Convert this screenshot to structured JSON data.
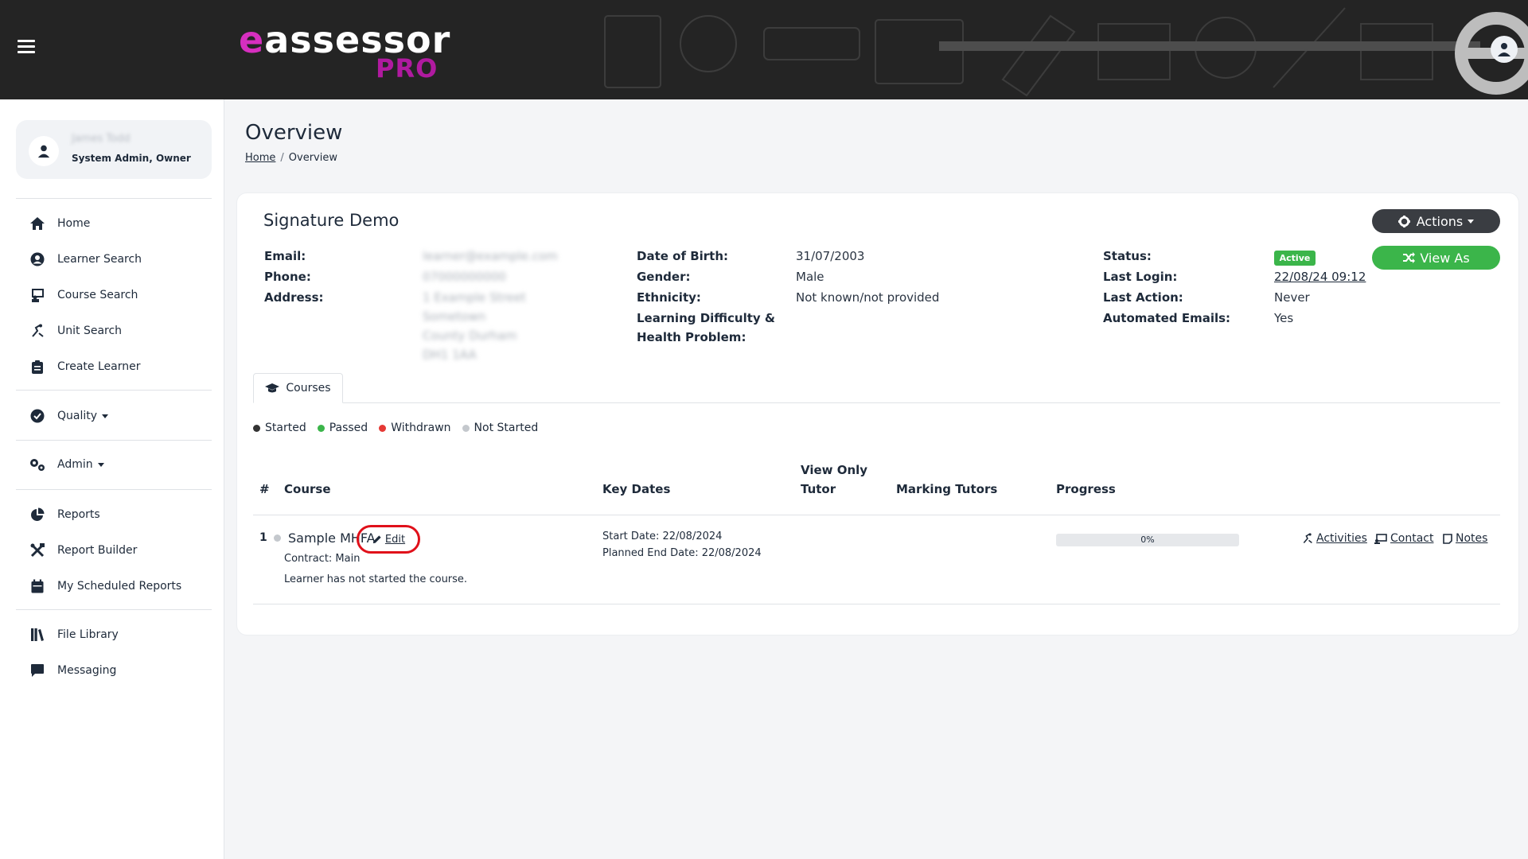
{
  "app": {
    "logo_main_e": "e",
    "logo_main_rest": "assessor",
    "logo_sub": "PRO"
  },
  "user": {
    "name": "James Todd",
    "role": "System Admin, Owner"
  },
  "nav": {
    "home": "Home",
    "learner_search": "Learner Search",
    "course_search": "Course Search",
    "unit_search": "Unit Search",
    "create_learner": "Create Learner",
    "quality": "Quality",
    "admin": "Admin",
    "reports": "Reports",
    "report_builder": "Report Builder",
    "scheduled_reports": "My Scheduled Reports",
    "file_library": "File Library",
    "messaging": "Messaging"
  },
  "page": {
    "title": "Overview",
    "breadcrumb_home": "Home",
    "breadcrumb_current": "Overview"
  },
  "learner": {
    "name": "Signature Demo",
    "actions_label": "Actions",
    "view_as_label": "View As",
    "email_label": "Email:",
    "email_value": "learner@example.com",
    "phone_label": "Phone:",
    "phone_value": "07000000000",
    "address_label": "Address:",
    "address_lines": [
      "1 Example Street",
      "Sometown",
      "County Durham",
      "DH1 1AA"
    ],
    "dob_label": "Date of Birth:",
    "dob_value": "31/07/2003",
    "gender_label": "Gender:",
    "gender_value": "Male",
    "ethnicity_label": "Ethnicity:",
    "ethnicity_value": "Not known/not provided",
    "ldd_label_1": "Learning Difficulty &",
    "ldd_label_2": "Health Problem:",
    "status_label": "Status:",
    "status_value": "Active",
    "last_login_label": "Last Login:",
    "last_login_value": "22/08/24 09:12",
    "last_action_label": "Last Action:",
    "last_action_value": "Never",
    "auto_emails_label": "Automated Emails:",
    "auto_emails_value": "Yes"
  },
  "tabs": {
    "courses": "Courses"
  },
  "legend": [
    {
      "label": "Started",
      "color": "#333333"
    },
    {
      "label": "Passed",
      "color": "#3bb54a"
    },
    {
      "label": "Withdrawn",
      "color": "#e53935"
    },
    {
      "label": "Not Started",
      "color": "#c4c8cd"
    }
  ],
  "table": {
    "headers": {
      "num": "#",
      "course": "Course",
      "key_dates": "Key Dates",
      "view_only_1": "View Only",
      "view_only_2": "Tutor",
      "marking_tutors": "Marking Tutors",
      "progress": "Progress"
    },
    "rows": [
      {
        "num": "1",
        "course": "Sample MHFA",
        "edit": "Edit",
        "contract": "Contract: Main",
        "note": "Learner has not started the course.",
        "start_date": "Start Date: 22/08/2024",
        "planned_end": "Planned End Date: 22/08/2024",
        "progress": 0,
        "progress_text": "0%",
        "link_activities": "Activities",
        "link_contact": "Contact",
        "link_notes": "Notes"
      }
    ]
  }
}
